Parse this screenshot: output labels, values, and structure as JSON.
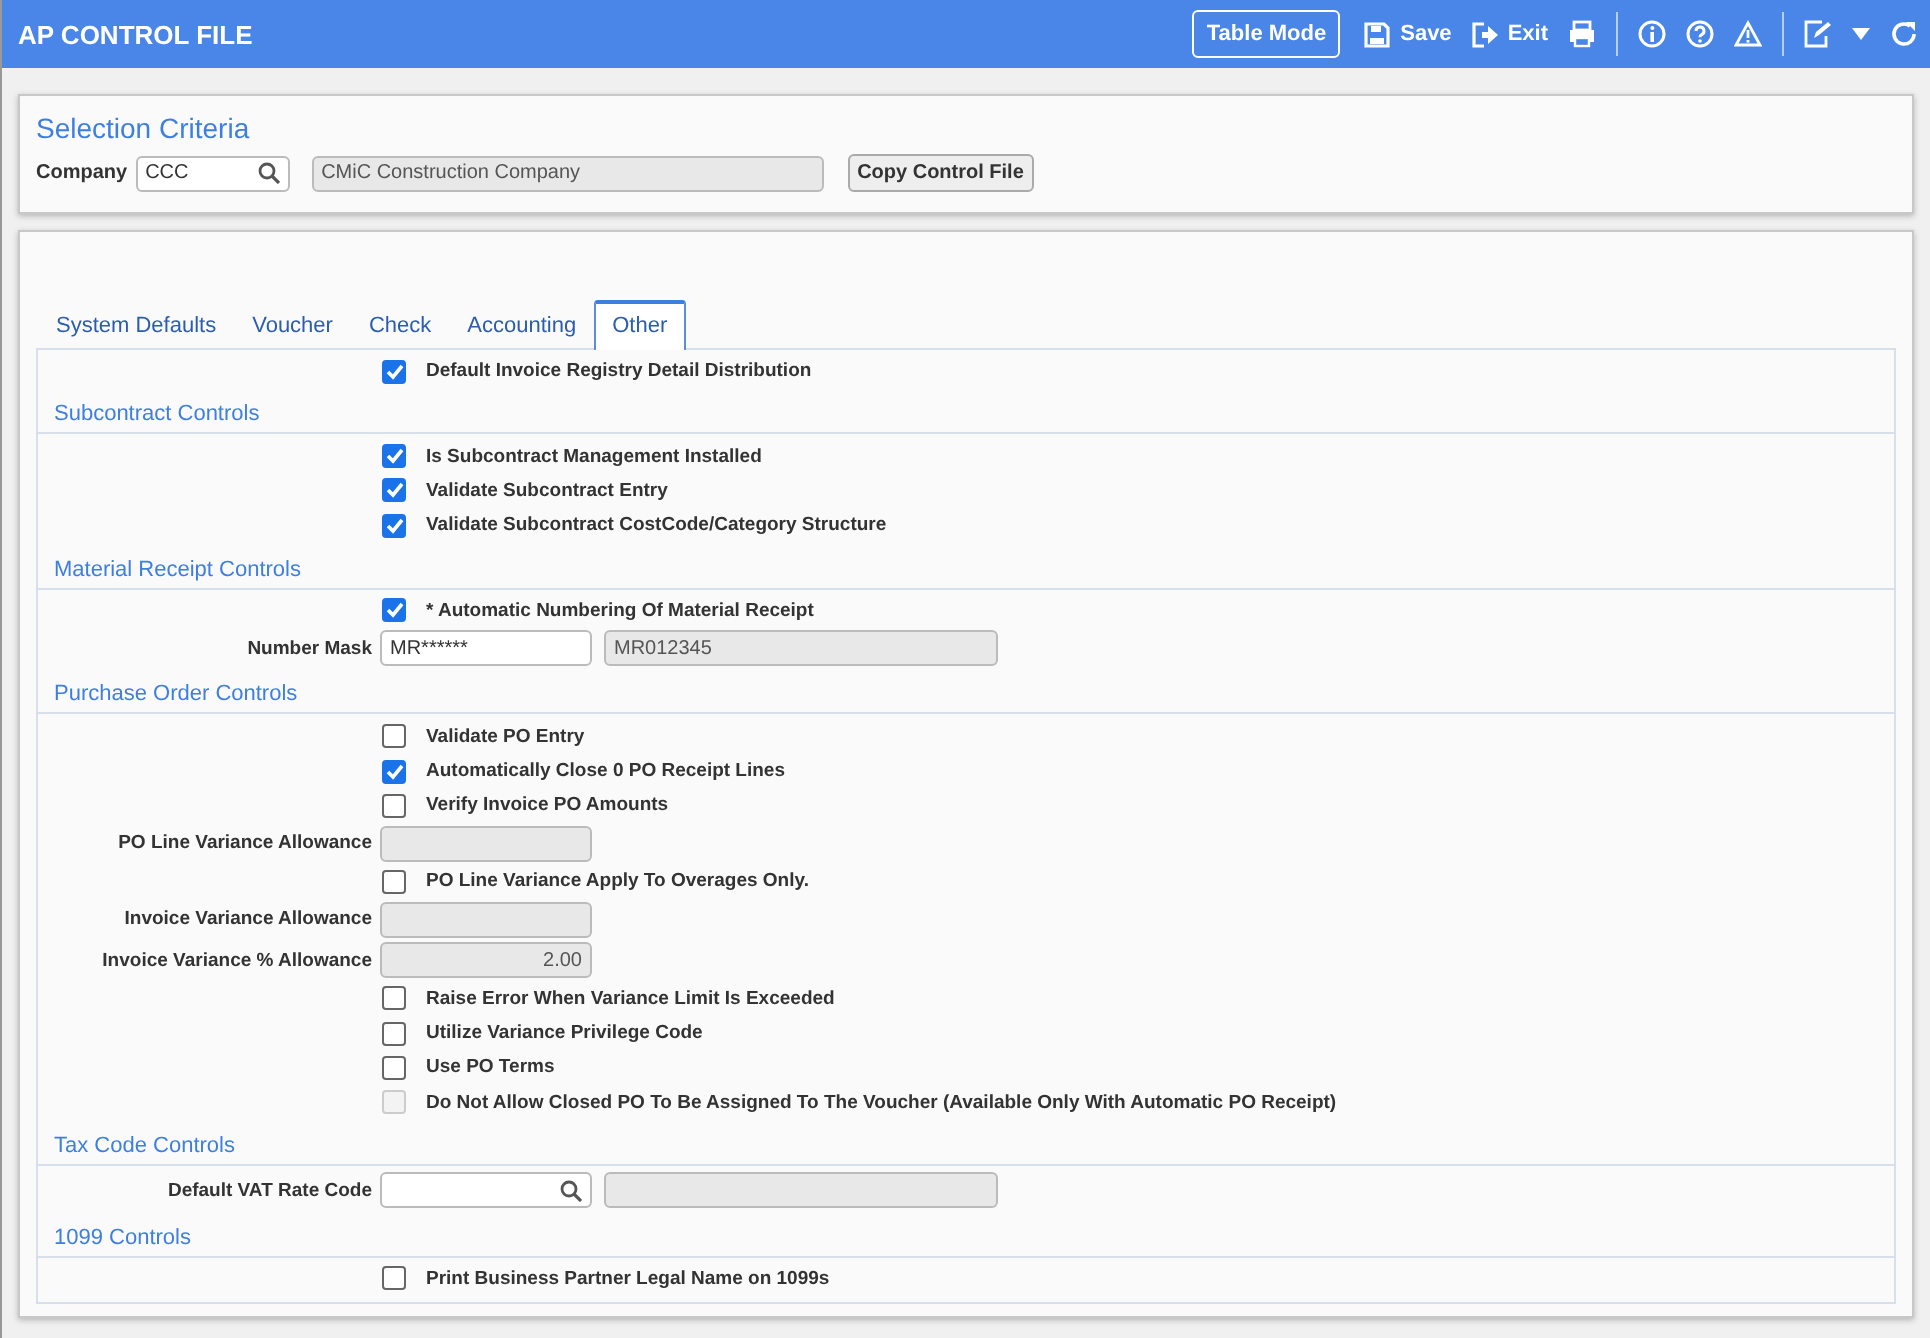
{
  "window": {
    "title": "AP CONTROL FILE"
  },
  "toolbar": [
    {
      "label": "Table Mode",
      "kind": "outlined"
    },
    {
      "label": "Save",
      "kind": "save"
    },
    {
      "label": "Exit",
      "kind": "exit"
    }
  ],
  "selection": {
    "title": "Selection Criteria",
    "company_label": "Company",
    "company_value": "CCC",
    "company_name": "CMiC Construction Company",
    "copy_button": "Copy Control File"
  },
  "tabs": [
    {
      "label": "System Defaults",
      "selected": false
    },
    {
      "label": "Voucher",
      "selected": false
    },
    {
      "label": "Check",
      "selected": false
    },
    {
      "label": "Accounting",
      "selected": false
    },
    {
      "label": "Other",
      "selected": true
    }
  ],
  "sections": [
    {
      "rows": [
        {
          "kind": "checkbox",
          "label": "Default Invoice Registry Detail Distribution",
          "checked": true,
          "disabled": false
        }
      ]
    },
    {
      "title": "Subcontract Controls",
      "rows": [
        {
          "kind": "checkbox",
          "label": "Is Subcontract Management Installed",
          "checked": true,
          "disabled": false
        },
        {
          "kind": "checkbox",
          "label": "Validate Subcontract Entry",
          "checked": true,
          "disabled": false
        },
        {
          "kind": "checkbox",
          "label": "Validate Subcontract CostCode/Category Structure",
          "checked": true,
          "disabled": false
        }
      ]
    },
    {
      "title": "Material Receipt Controls",
      "rows": [
        {
          "kind": "checkbox",
          "label": "* Automatic Numbering Of Material Receipt",
          "checked": true,
          "disabled": false
        },
        {
          "kind": "field",
          "label": "Number Mask",
          "value": "MR******",
          "editable": true,
          "lookup": false,
          "numeric": false,
          "companion": true,
          "companion_value": "MR012345"
        }
      ]
    },
    {
      "title": "Purchase Order Controls",
      "rows": [
        {
          "kind": "checkbox",
          "label": "Validate PO Entry",
          "checked": false,
          "disabled": false
        },
        {
          "kind": "checkbox",
          "label": "Automatically Close 0 PO Receipt Lines",
          "checked": true,
          "disabled": false
        },
        {
          "kind": "checkbox",
          "label": "Verify Invoice PO Amounts",
          "checked": false,
          "disabled": false
        },
        {
          "kind": "field",
          "label": "PO Line Variance Allowance",
          "editable": false,
          "lookup": false,
          "companion": false
        },
        {
          "kind": "checkbox",
          "label": "PO Line Variance Apply To Overages Only.",
          "checked": false,
          "disabled": false
        },
        {
          "kind": "field",
          "label": "Invoice Variance Allowance",
          "editable": false,
          "lookup": false,
          "companion": false
        },
        {
          "kind": "field",
          "label": "Invoice Variance % Allowance",
          "value": "2.00",
          "editable": false,
          "lookup": false,
          "numeric": true,
          "companion": false
        },
        {
          "kind": "checkbox",
          "label": "Raise Error When Variance Limit Is Exceeded",
          "checked": false,
          "disabled": false
        },
        {
          "kind": "checkbox",
          "label": "Utilize Variance Privilege Code",
          "checked": false,
          "disabled": false
        },
        {
          "kind": "checkbox",
          "label": "Use PO Terms",
          "checked": false,
          "disabled": false
        },
        {
          "kind": "checkbox",
          "label": "Do Not Allow Closed PO To Be Assigned To The Voucher (Available Only With Automatic PO Receipt)",
          "checked": false,
          "disabled": true
        }
      ]
    },
    {
      "title": "Tax Code Controls",
      "rows": [
        {
          "kind": "field",
          "label": "Default VAT Rate Code",
          "editable": true,
          "lookup": true,
          "companion": true
        }
      ]
    },
    {
      "title": "1099 Controls",
      "rows": [
        {
          "kind": "checkbox",
          "label": "Print Business Partner Legal Name on 1099s",
          "checked": false,
          "disabled": false
        }
      ]
    }
  ]
}
